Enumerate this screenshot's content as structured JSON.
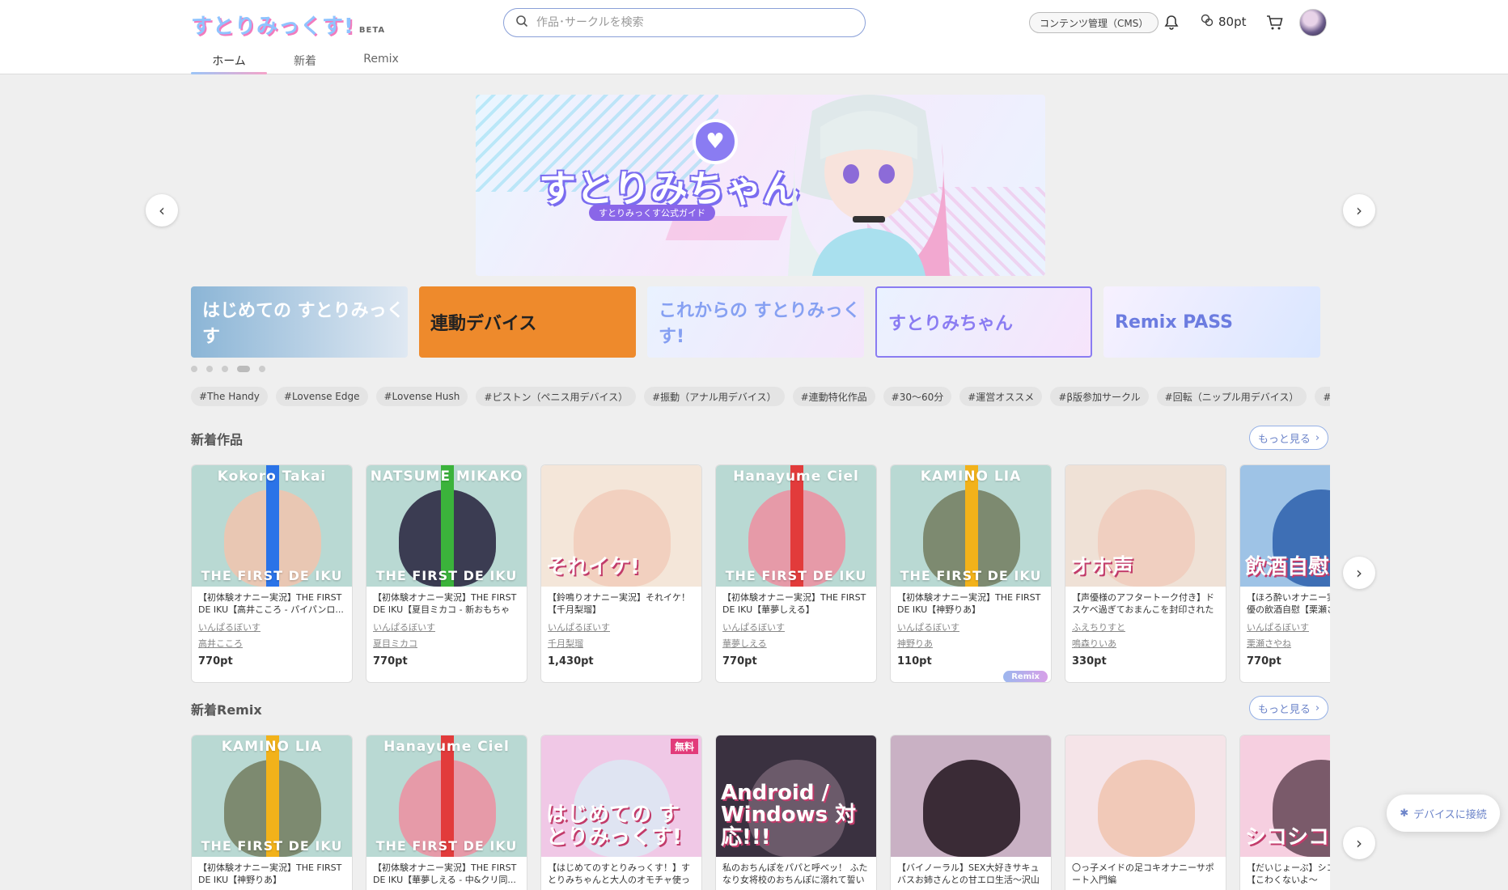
{
  "header": {
    "logo_text": "すとりみっくす!",
    "beta_label": "BETA",
    "search_placeholder": "作品･サークルを検索",
    "cms_label": "コンテンツ管理（CMS）",
    "points_label": "80pt",
    "icons": [
      "search-icon",
      "bell-icon",
      "points-icon",
      "cart-icon"
    ]
  },
  "tabs": [
    {
      "label": "ホーム",
      "active": true
    },
    {
      "label": "新着",
      "active": false
    },
    {
      "label": "Remix",
      "active": false
    }
  ],
  "hero": {
    "title": "すとりみちゃん",
    "subtitle": "すとりみっくす公式ガイド",
    "prev_arrow": "‹",
    "next_arrow": "›"
  },
  "banners": [
    {
      "text": "はじめての すとりみっくす"
    },
    {
      "text": "連動デバイス"
    },
    {
      "text": "これからの すとりみっくす!"
    },
    {
      "text": "すとりみちゃん"
    },
    {
      "text": "Remix PASS"
    }
  ],
  "carousel": {
    "dot_count": 5,
    "active_index": 3
  },
  "tags": [
    "#The Handy",
    "#Lovense Edge",
    "#Lovense Hush",
    "#ピストン（ペニス用デバイス）",
    "#振動（アナル用デバイス）",
    "#連動特化作品",
    "#30〜60分",
    "#運営オススメ",
    "#β版参加サークル",
    "#回転（ニップル用デバイス）",
    "#振動（ニップル用デバイス）",
    "#"
  ],
  "new_works": {
    "title": "新着作品",
    "more_label": "もっと見る",
    "items": [
      {
        "name": "Kokoro Takai",
        "tfd": "THE FIRST DE IKU",
        "band": "#2a73e8",
        "bg": "#b9d9d3",
        "face": "#e9c7b3",
        "title": "【初体験オナニー実況】THE FIRST DE IKU【高井こころ - パイパンロ...",
        "circle": "いんぱるぼいす",
        "cv": "高井こころ",
        "price": "770pt",
        "remix": false
      },
      {
        "name": "NATSUME MIKAKO",
        "tfd": "THE FIRST DE IKU",
        "band": "#3bb33b",
        "bg": "#b9d9d3",
        "face": "#3b3c52",
        "title": "【初体験オナニー実況】THE FIRST DE IKU【夏目ミカコ - 新おもちゃ編】",
        "circle": "いんぱるぼいす",
        "cv": "夏目ミカコ",
        "price": "770pt",
        "remix": false
      },
      {
        "name": "",
        "tfd": "",
        "big": "それイケ!",
        "band": "",
        "bg": "#f4e6d9",
        "face": "#f2d0bf",
        "title": "【鈴鳴りオナニー実況】それイケ！【千月梨瑠】",
        "circle": "いんぱるぼいす",
        "cv": "千月梨瑠",
        "price": "1,430pt",
        "remix": false
      },
      {
        "name": "Hanayume Ciel",
        "tfd": "THE FIRST DE IKU",
        "band": "#e23b3b",
        "bg": "#b9d9d3",
        "face": "#e69aa8",
        "title": "【初体験オナニー実況】THE FIRST DE IKU【華夢しえる】",
        "circle": "いんぱるぼいす",
        "cv": "華夢しえる",
        "price": "770pt",
        "remix": false
      },
      {
        "name": "KAMINO LIA",
        "tfd": "THE FIRST DE IKU",
        "band": "#f2b21a",
        "bg": "#b9d9d3",
        "face": "#7d8a70",
        "title": "【初体験オナニー実況】THE FIRST DE IKU【神野りあ】",
        "circle": "いんぱるぼいす",
        "cv": "神野りあ",
        "price": "110pt",
        "remix": true
      },
      {
        "name": "",
        "tfd": "",
        "big": "オホ声",
        "band": "",
        "bg": "#efe1d6",
        "face": "#f0cfc0",
        "title": "【声優様のアフタートーク付き】ドスケベ過ぎておまんこを封印された「のじゃ...",
        "circle": "ふえちりすと",
        "cv": "鳴森りいあ",
        "price": "330pt",
        "remix": false
      },
      {
        "name": "",
        "tfd": "",
        "big": "飲酒自慰",
        "band": "",
        "bg": "#9ec3e6",
        "face": "#3e6fb5",
        "title": "【ほろ酔いオナニー実況】とある声優の飲酒自慰【栗瀬さやね】",
        "circle": "いんぱるぼいす",
        "cv": "栗瀬さやね",
        "price": "770pt",
        "remix": false
      }
    ],
    "remix_badge": "Remix"
  },
  "new_remix": {
    "title": "新着Remix",
    "more_label": "もっと見る",
    "items": [
      {
        "name": "KAMINO LIA",
        "tfd": "THE FIRST DE IKU",
        "band": "#f2b21a",
        "bg": "#b9d9d3",
        "face": "#7d8a70",
        "title": "【初体験オナニー実況】THE FIRST DE IKU【神野りあ】",
        "badge": ""
      },
      {
        "name": "Hanayume Ciel",
        "tfd": "THE FIRST DE IKU",
        "band": "#e23b3b",
        "bg": "#b9d9d3",
        "face": "#e69aa8",
        "title": "【初体験オナニー実況】THE FIRST DE IKU【華夢しえる - 中&クリ同...",
        "badge": ""
      },
      {
        "name": "",
        "tfd": "",
        "big": "はじめての すとりみっくす!",
        "band": "",
        "bg": "#f0c8e6",
        "face": "#dfe4f2",
        "title": "【はじめてのすとりみっくす！】すとりみちゃんと大人のオモチャ使ってみよ♪",
        "badge": "無料"
      },
      {
        "name": "",
        "tfd": "",
        "big": "Android / Windows 対応!!!",
        "band": "",
        "bg": "#3a3140",
        "face": "#6b5a6a",
        "title": "私のおちんぽをパパと呼べッ！ ふたなり女将校のおちんぽに溺れて誓いの...",
        "badge": ""
      },
      {
        "name": "",
        "tfd": "",
        "big": "",
        "band": "",
        "bg": "#c9b1c4",
        "face": "#3a2b36",
        "title": "【バイノーラル】SEX大好きサキュバスお姉さんとの甘エロ生活〜沢山搾り...",
        "badge": ""
      },
      {
        "name": "",
        "tfd": "",
        "big": "",
        "band": "",
        "bg": "#f5e4e8",
        "face": "#f1c9b8",
        "title": "〇っ子メイドの足コキオナニーサポート入門編",
        "badge": ""
      },
      {
        "name": "",
        "tfd": "",
        "big": "シコシコボイス",
        "band": "",
        "bg": "#f6cfe0",
        "face": "#7a5a6a",
        "title": "【だいじょーぶ】シコシコ音夢編【こわくないよ〜",
        "badge": ""
      }
    ]
  },
  "device_button": "デバイスに接続",
  "colors": {
    "accent": "#8aa0d8",
    "pink": "#f5a4c9",
    "remix_badge": "#b8a8ee"
  }
}
